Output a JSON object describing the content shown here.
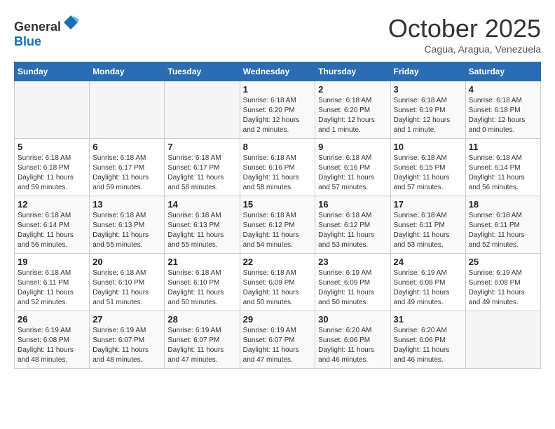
{
  "header": {
    "logo_general": "General",
    "logo_blue": "Blue",
    "month": "October 2025",
    "location": "Cagua, Aragua, Venezuela"
  },
  "days_of_week": [
    "Sunday",
    "Monday",
    "Tuesday",
    "Wednesday",
    "Thursday",
    "Friday",
    "Saturday"
  ],
  "weeks": [
    [
      {
        "day": "",
        "info": ""
      },
      {
        "day": "",
        "info": ""
      },
      {
        "day": "",
        "info": ""
      },
      {
        "day": "1",
        "info": "Sunrise: 6:18 AM\nSunset: 6:20 PM\nDaylight: 12 hours\nand 2 minutes."
      },
      {
        "day": "2",
        "info": "Sunrise: 6:18 AM\nSunset: 6:20 PM\nDaylight: 12 hours\nand 1 minute."
      },
      {
        "day": "3",
        "info": "Sunrise: 6:18 AM\nSunset: 6:19 PM\nDaylight: 12 hours\nand 1 minute."
      },
      {
        "day": "4",
        "info": "Sunrise: 6:18 AM\nSunset: 6:18 PM\nDaylight: 12 hours\nand 0 minutes."
      }
    ],
    [
      {
        "day": "5",
        "info": "Sunrise: 6:18 AM\nSunset: 6:18 PM\nDaylight: 11 hours\nand 59 minutes."
      },
      {
        "day": "6",
        "info": "Sunrise: 6:18 AM\nSunset: 6:17 PM\nDaylight: 11 hours\nand 59 minutes."
      },
      {
        "day": "7",
        "info": "Sunrise: 6:18 AM\nSunset: 6:17 PM\nDaylight: 11 hours\nand 58 minutes."
      },
      {
        "day": "8",
        "info": "Sunrise: 6:18 AM\nSunset: 6:16 PM\nDaylight: 11 hours\nand 58 minutes."
      },
      {
        "day": "9",
        "info": "Sunrise: 6:18 AM\nSunset: 6:16 PM\nDaylight: 11 hours\nand 57 minutes."
      },
      {
        "day": "10",
        "info": "Sunrise: 6:18 AM\nSunset: 6:15 PM\nDaylight: 11 hours\nand 57 minutes."
      },
      {
        "day": "11",
        "info": "Sunrise: 6:18 AM\nSunset: 6:14 PM\nDaylight: 11 hours\nand 56 minutes."
      }
    ],
    [
      {
        "day": "12",
        "info": "Sunrise: 6:18 AM\nSunset: 6:14 PM\nDaylight: 11 hours\nand 56 minutes."
      },
      {
        "day": "13",
        "info": "Sunrise: 6:18 AM\nSunset: 6:13 PM\nDaylight: 11 hours\nand 55 minutes."
      },
      {
        "day": "14",
        "info": "Sunrise: 6:18 AM\nSunset: 6:13 PM\nDaylight: 11 hours\nand 55 minutes."
      },
      {
        "day": "15",
        "info": "Sunrise: 6:18 AM\nSunset: 6:12 PM\nDaylight: 11 hours\nand 54 minutes."
      },
      {
        "day": "16",
        "info": "Sunrise: 6:18 AM\nSunset: 6:12 PM\nDaylight: 11 hours\nand 53 minutes."
      },
      {
        "day": "17",
        "info": "Sunrise: 6:18 AM\nSunset: 6:11 PM\nDaylight: 11 hours\nand 53 minutes."
      },
      {
        "day": "18",
        "info": "Sunrise: 6:18 AM\nSunset: 6:11 PM\nDaylight: 11 hours\nand 52 minutes."
      }
    ],
    [
      {
        "day": "19",
        "info": "Sunrise: 6:18 AM\nSunset: 6:11 PM\nDaylight: 11 hours\nand 52 minutes."
      },
      {
        "day": "20",
        "info": "Sunrise: 6:18 AM\nSunset: 6:10 PM\nDaylight: 11 hours\nand 51 minutes."
      },
      {
        "day": "21",
        "info": "Sunrise: 6:18 AM\nSunset: 6:10 PM\nDaylight: 11 hours\nand 50 minutes."
      },
      {
        "day": "22",
        "info": "Sunrise: 6:18 AM\nSunset: 6:09 PM\nDaylight: 11 hours\nand 50 minutes."
      },
      {
        "day": "23",
        "info": "Sunrise: 6:19 AM\nSunset: 6:09 PM\nDaylight: 11 hours\nand 50 minutes."
      },
      {
        "day": "24",
        "info": "Sunrise: 6:19 AM\nSunset: 6:08 PM\nDaylight: 11 hours\nand 49 minutes."
      },
      {
        "day": "25",
        "info": "Sunrise: 6:19 AM\nSunset: 6:08 PM\nDaylight: 11 hours\nand 49 minutes."
      }
    ],
    [
      {
        "day": "26",
        "info": "Sunrise: 6:19 AM\nSunset: 6:08 PM\nDaylight: 11 hours\nand 48 minutes."
      },
      {
        "day": "27",
        "info": "Sunrise: 6:19 AM\nSunset: 6:07 PM\nDaylight: 11 hours\nand 48 minutes."
      },
      {
        "day": "28",
        "info": "Sunrise: 6:19 AM\nSunset: 6:07 PM\nDaylight: 11 hours\nand 47 minutes."
      },
      {
        "day": "29",
        "info": "Sunrise: 6:19 AM\nSunset: 6:07 PM\nDaylight: 11 hours\nand 47 minutes."
      },
      {
        "day": "30",
        "info": "Sunrise: 6:20 AM\nSunset: 6:06 PM\nDaylight: 11 hours\nand 46 minutes."
      },
      {
        "day": "31",
        "info": "Sunrise: 6:20 AM\nSunset: 6:06 PM\nDaylight: 11 hours\nand 46 minutes."
      },
      {
        "day": "",
        "info": ""
      }
    ]
  ]
}
